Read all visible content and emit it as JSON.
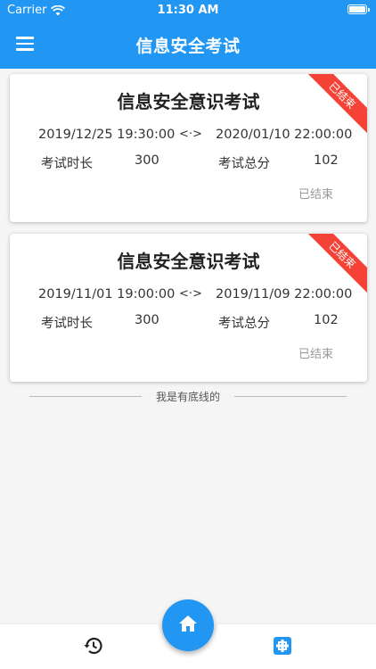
{
  "status_bar": {
    "carrier": "Carrier",
    "time": "11:30 AM"
  },
  "app_bar": {
    "title": "信息安全考试",
    "menu_icon": "menu-icon"
  },
  "exams": [
    {
      "title": "信息安全意识考试",
      "ribbon": "已结束",
      "start": "2019/12/25 19:30:00",
      "separator": "<·>",
      "end": "2020/01/10 22:00:00",
      "duration_label": "考试时长",
      "duration": "300",
      "score_label": "考试总分",
      "score": "102",
      "status": "已结束"
    },
    {
      "title": "信息安全意识考试",
      "ribbon": "已结束",
      "start": "2019/11/01 19:00:00",
      "separator": "<·>",
      "end": "2019/11/09 22:00:00",
      "duration_label": "考试时长",
      "duration": "300",
      "score_label": "考试总分",
      "score": "102",
      "status": "已结束"
    }
  ],
  "list_end_text": "我是有底线的",
  "bottom_nav": {
    "left_icon": "history-icon",
    "center_icon": "home-icon",
    "right_icon": "exam-icon"
  },
  "colors": {
    "primary": "#2196f3",
    "ribbon": "#f44336",
    "background": "#f5f5f5"
  }
}
